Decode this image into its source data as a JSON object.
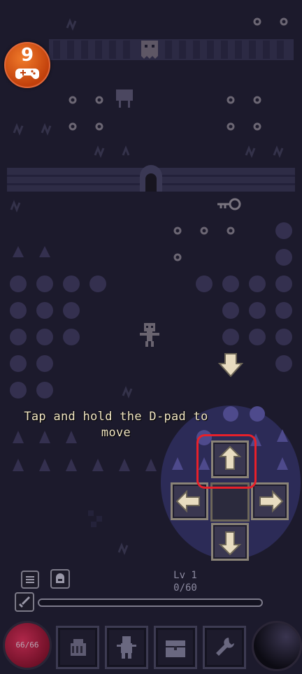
{
  "app_badge": {
    "number": "9",
    "icon": "gamepad-icon"
  },
  "tutorial": {
    "text": "Tap and hold the D-pad to move"
  },
  "hud": {
    "level_label": "Lv 1",
    "xp_text": "0/60",
    "xp_fraction": 0.0,
    "hp_text": "66/66"
  },
  "colors": {
    "background": "#1c1a2c",
    "tutorial_text": "#f2e6c4",
    "highlight": "#e8202a",
    "hp_orb": "#b0274a"
  },
  "toolbar": {
    "slots": [
      "bag-icon",
      "character-icon",
      "chest-icon",
      "wrench-icon"
    ]
  }
}
